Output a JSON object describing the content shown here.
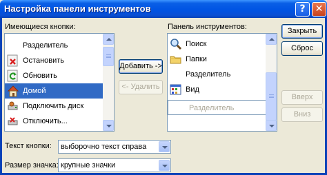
{
  "window": {
    "title": "Настройка панели инструментов",
    "help_glyph": "?",
    "close_glyph": "✕"
  },
  "available": {
    "label": "Имеющиеся кнопки:",
    "items": [
      {
        "label": "Разделитель",
        "icon": "none"
      },
      {
        "label": "Остановить",
        "icon": "stop-icon"
      },
      {
        "label": "Обновить",
        "icon": "refresh-icon"
      },
      {
        "label": "Домой",
        "icon": "home-icon",
        "selected": true
      },
      {
        "label": "Подключить диск",
        "icon": "map-drive-icon"
      },
      {
        "label": "Отключить...",
        "icon": "disconnect-icon"
      }
    ]
  },
  "current": {
    "label": "Панель инструментов:",
    "items": [
      {
        "label": "Поиск",
        "icon": "search-icon"
      },
      {
        "label": "Папки",
        "icon": "folders-icon"
      },
      {
        "label": "Разделитель",
        "icon": "none"
      },
      {
        "label": "Вид",
        "icon": "views-icon"
      },
      {
        "label": "Разделитель",
        "icon": "none",
        "placeholder": true
      }
    ]
  },
  "buttons": {
    "add": "Добавить ->",
    "remove": "<- Удалить",
    "close": "Закрыть",
    "reset": "Сброс",
    "up": "Вверх",
    "down": "Вниз"
  },
  "options": {
    "text_label": "Текст кнопки:",
    "text_value": "выборочно текст справа",
    "icon_label": "Размер значка:",
    "icon_value": "крупные значки"
  },
  "colors": {
    "titlebar": "#0054e3",
    "selection": "#316ac5",
    "dialog_bg": "#ece9d8"
  }
}
